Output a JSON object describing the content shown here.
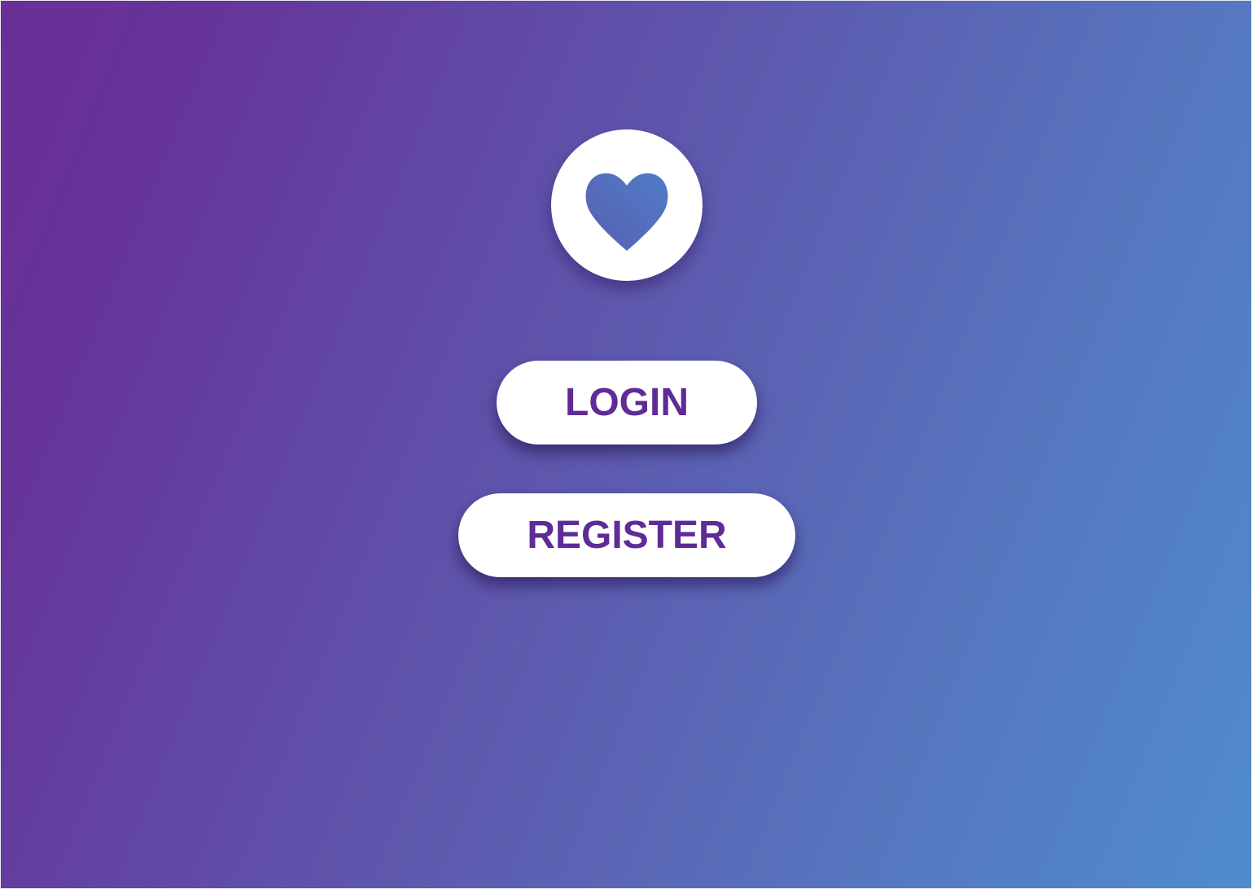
{
  "app": {
    "logo": {
      "icon": "heart-icon",
      "heart_gradient": [
        "#5a5fb2",
        "#4f7cc6"
      ]
    },
    "actions": {
      "login_label": "LOGIN",
      "register_label": "REGISTER"
    },
    "colors": {
      "background_start": "#663399",
      "background_end": "#4f8ccc",
      "button_background": "#ffffff",
      "button_text": "#5e2b97"
    }
  }
}
